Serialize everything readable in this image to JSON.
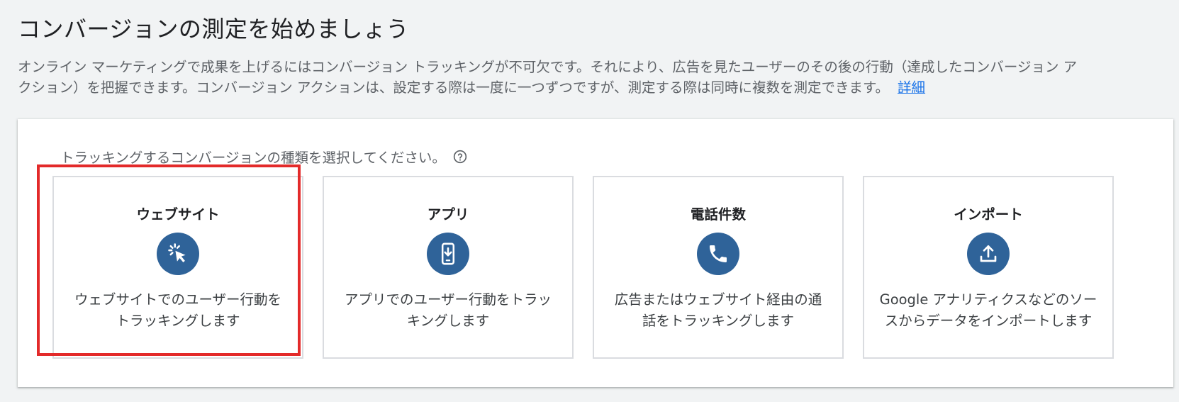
{
  "header": {
    "title": "コンバージョンの測定を始めましょう",
    "intro_line1": "オンライン マーケティングで成果を上げるにはコンバージョン トラッキングが不可欠です。それにより、広告を見たユーザーのその後の行動（達成したコンバージョン ア",
    "intro_line2": "クション）を把握できます。コンバージョン アクションは、設定する際は一度に一つずつですが、測定する際は同時に複数を測定できます。",
    "learn_more": "詳細"
  },
  "panel": {
    "prompt": "トラッキングするコンバージョンの種類を選択してください。",
    "help_icon": "help-circle-icon",
    "cards": [
      {
        "title": "ウェブサイト",
        "icon": "cursor-click-icon",
        "desc_line1": "ウェブサイトでのユーザー行動を",
        "desc_line2": "トラッキングします",
        "selected": true
      },
      {
        "title": "アプリ",
        "icon": "phone-download-icon",
        "desc_line1": "アプリでのユーザー行動をトラッ",
        "desc_line2": "キングします",
        "selected": false
      },
      {
        "title": "電話件数",
        "icon": "phone-call-icon",
        "desc_line1": "広告またはウェブサイト経由の通",
        "desc_line2": "話をトラッキングします",
        "selected": false
      },
      {
        "title": "インポート",
        "icon": "upload-icon",
        "desc_line1": "Google アナリティクスなどのソー",
        "desc_line2": "スからデータをインポートします",
        "selected": false
      }
    ]
  },
  "colors": {
    "background": "#f1f3f4",
    "icon_circle": "#2f6399",
    "link": "#1a73e8",
    "highlight": "#e32a2a"
  }
}
